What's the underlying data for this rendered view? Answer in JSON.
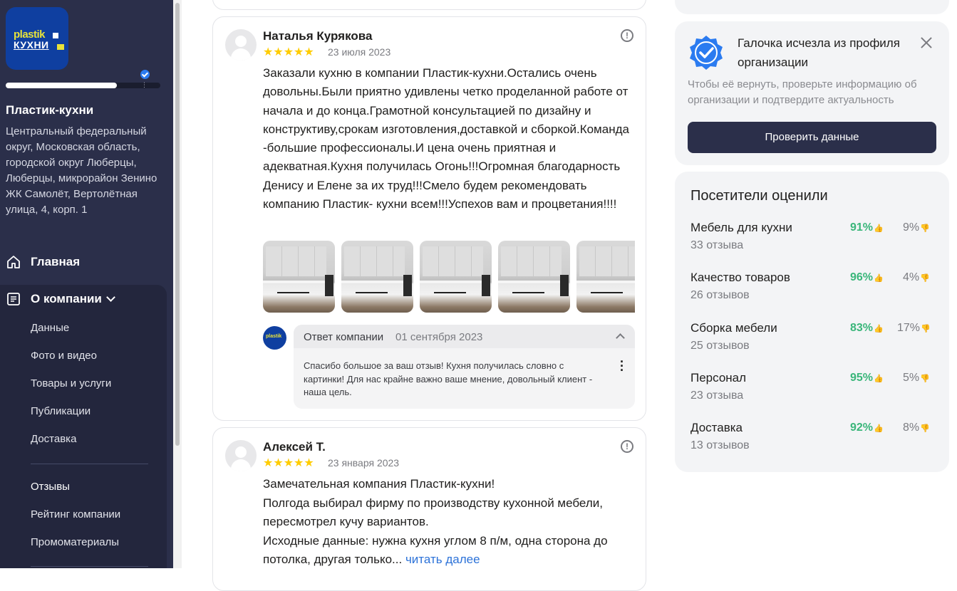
{
  "sidebar": {
    "logo_line1": "plastik",
    "logo_line2": "КУХНИ",
    "progress": 0.72,
    "org_name": "Пластик-кухни",
    "address": "Центральный федеральный округ, Московская область, городской округ Люберцы, Люберцы, микрорайон Зенино ЖК Самолёт, Вертолётная улица, 4, корп. 1",
    "home_label": "Главная",
    "about_label": "О компании",
    "sub_items": [
      "Данные",
      "Фото и видео",
      "Товары и услуги",
      "Публикации",
      "Доставка"
    ],
    "sub_items2": [
      "Отзывы",
      "Рейтинг компании",
      "Промоматериалы"
    ]
  },
  "reviews": [
    {
      "author": "Наталья Курякова",
      "stars": "★★★★★",
      "rating": 5,
      "date": "23 июля 2023",
      "text": "Заказали кухню в компании Пластик-кухни.Остались очень довольны.Были приятно удивлены четко проделанной работе от начала и до конца.Грамотной консультацией по дизайну и конструктиву,срокам изготовления,доставкой и сборкой.Команда -большие профессионалы.И цена очень приятная и адекватная.Кухня получилась Огонь!!!Огромная благодарность Денису и Елене за их труд!!!Смело будем рекомендовать компанию Пластик- кухни всем!!!Успехов вам и процветания!!!!",
      "photo_count": 5,
      "reply": {
        "title": "Ответ компании",
        "date": "01 сентября 2023",
        "text": "Спасибо большое за ваш отзыв! Кухня получилась словно с картинки! Для нас крайне важно ваше мнение, довольный клиент - наша цель."
      }
    },
    {
      "author": "Алексей Т.",
      "stars": "★★★★★",
      "rating": 5,
      "date": "23 января 2023",
      "text_line1": "Замечательная компания Пластик-кухни!",
      "text_line2": "Полгода выбирал фирму по производству кухонной мебели, пересмотрел кучу вариантов.",
      "text_line3": "Исходные данные: нужна кухня углом 8 п/м, одна сторона до потолка, другая только...",
      "read_more": "читать далее"
    }
  ],
  "notice": {
    "title": "Галочка исчезла из профиля организации",
    "description": "Чтобы её вернуть, проверьте информацию об организации и подтвердите актуальность",
    "button": "Проверить данные",
    "badge_color": "#2b7bf0"
  },
  "ratings": {
    "title": "Посетители оценили",
    "items": [
      {
        "name": "Мебель для кухни",
        "count": "33 отзыва",
        "positive": "91%",
        "negative": "9%"
      },
      {
        "name": "Качество товаров",
        "count": "26 отзывов",
        "positive": "96%",
        "negative": "4%"
      },
      {
        "name": "Сборка мебели",
        "count": "25 отзывов",
        "positive": "83%",
        "negative": "17%"
      },
      {
        "name": "Персонал",
        "count": "23 отзыва",
        "positive": "95%",
        "negative": "5%"
      },
      {
        "name": "Доставка",
        "count": "13 отзывов",
        "positive": "92%",
        "negative": "8%"
      }
    ]
  },
  "colors": {
    "sidebar_bg": "#2b2f4a",
    "positive": "#3ab67a",
    "star": "#ffcc00",
    "link": "#2c72d8"
  }
}
